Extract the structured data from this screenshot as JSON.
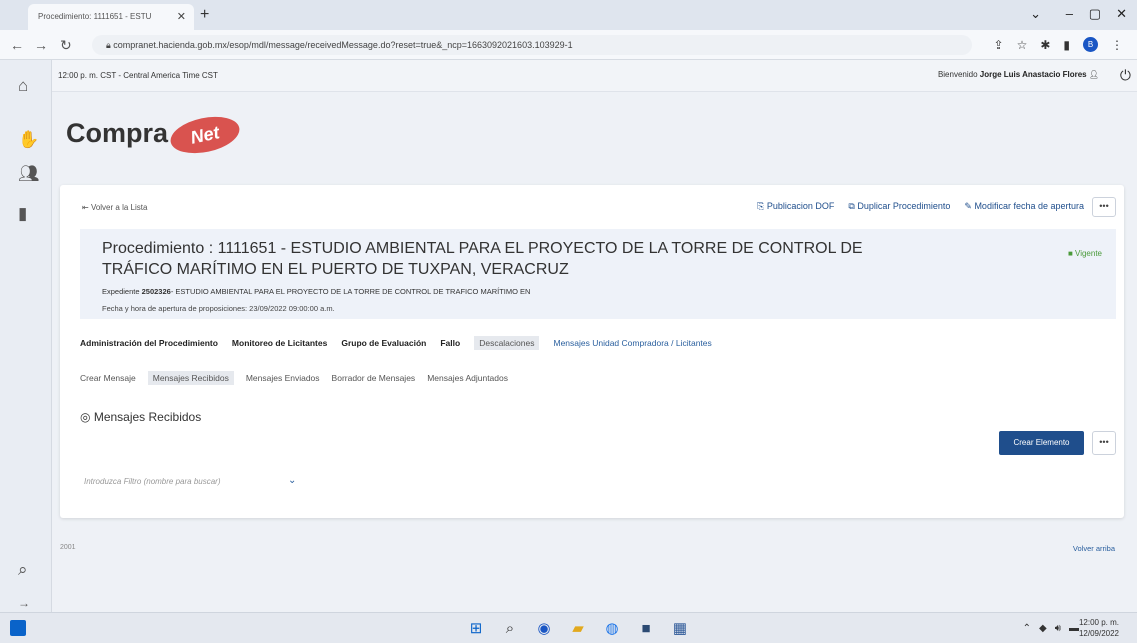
{
  "browser": {
    "tab_title": "Procedimiento: 1111651 - ESTU",
    "url": "compranet.hacienda.gob.mx/esop/mdl/message/receivedMessage.do?reset=true&_ncp=1663092021603.103929-1"
  },
  "header": {
    "time": "12:00 p. m. CST - Central America Time CST",
    "welcome_prefix": "Bienvenido",
    "user_name": "Jorge Luis Anastacio Flores"
  },
  "logo": {
    "text": "Compra",
    "badge": "Net"
  },
  "card": {
    "back": "Volver a la Lista",
    "actions": [
      "Publicacion DOF",
      "Duplicar Procedimiento",
      "Modificar fecha de apertura"
    ],
    "more": "•••"
  },
  "procedure": {
    "title": "Procedimiento : 1111651 - ESTUDIO AMBIENTAL PARA EL PROYECTO DE LA TORRE DE CONTROL DE TRÁFICO MARÍTIMO EN EL PUERTO DE TUXPAN, VERACRUZ",
    "status": "Vigente",
    "expediente_label": "Expediente",
    "expediente_num": "2502326",
    "expediente_desc": "- ESTUDIO AMBIENTAL PARA EL PROYECTO DE LA TORRE DE CONTROL DE TRAFICO MARÍTIMO EN",
    "fecha": "Fecha y hora de apertura de proposiciones: 23/09/2022 09:00:00 a.m."
  },
  "main_tabs": [
    "Administración del Procedimiento",
    "Monitoreo de Licitantes",
    "Grupo de Evaluación",
    "Fallo",
    "Descalaciones",
    "Mensajes Unidad Compradora / Licitantes"
  ],
  "sub_tabs": [
    "Crear Mensaje",
    "Mensajes Recibidos",
    "Mensajes Enviados",
    "Borrador de Mensajes",
    "Mensajes Adjuntados"
  ],
  "section": {
    "title": "Mensajes Recibidos",
    "create_button": "Crear Elemento",
    "more": "•••",
    "filter_placeholder": "Introduzca Filtro (nombre para buscar)"
  },
  "footer": {
    "left": "2001",
    "right": "Volver arriba"
  },
  "taskbar": {
    "time": "12:00 p. m.",
    "date": "12/09/2022"
  }
}
